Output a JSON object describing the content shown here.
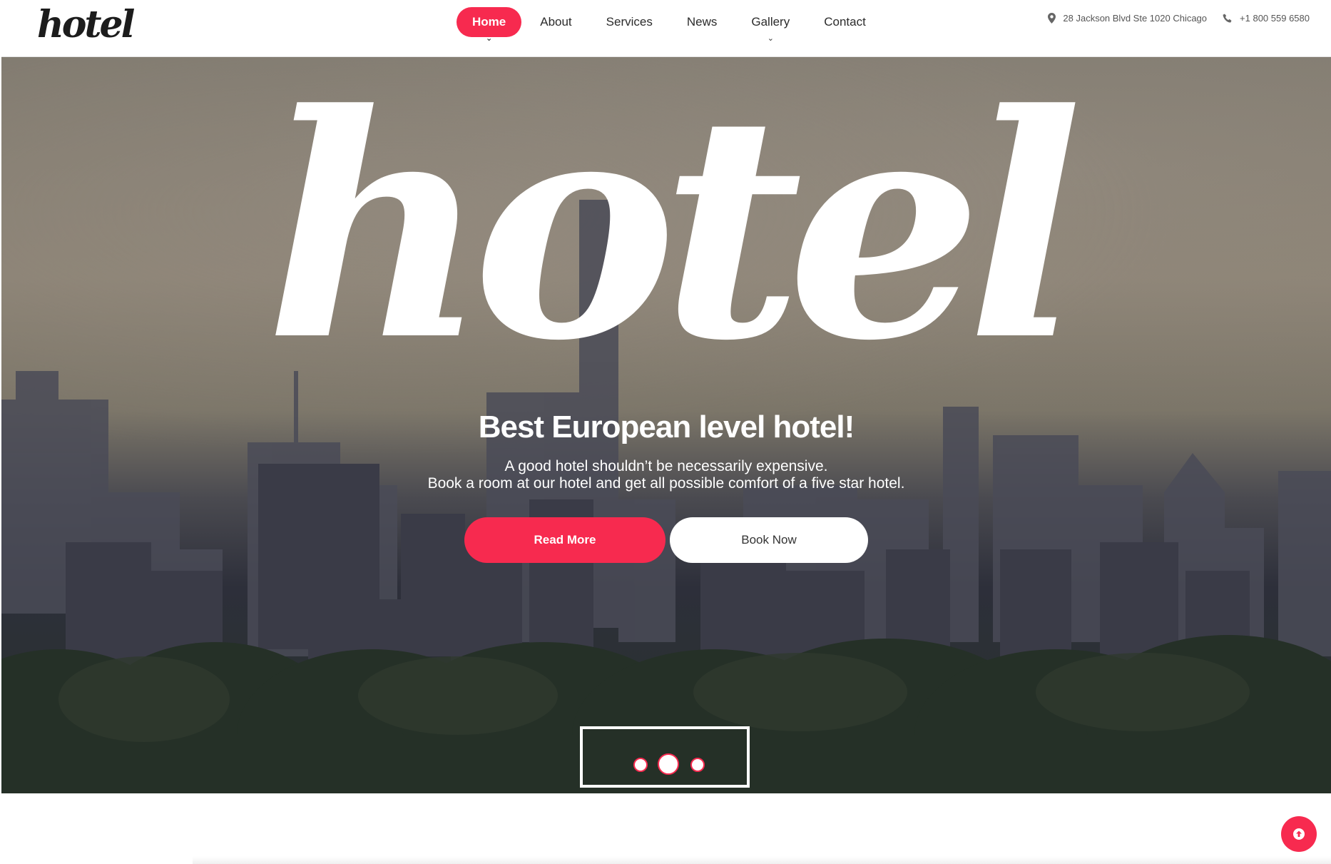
{
  "header": {
    "logo": "hotel",
    "nav": [
      {
        "label": "Home",
        "active": true,
        "has_dropdown": true
      },
      {
        "label": "About",
        "active": false,
        "has_dropdown": false
      },
      {
        "label": "Services",
        "active": false,
        "has_dropdown": false
      },
      {
        "label": "News",
        "active": false,
        "has_dropdown": false
      },
      {
        "label": "Gallery",
        "active": false,
        "has_dropdown": true
      },
      {
        "label": "Contact",
        "active": false,
        "has_dropdown": false
      }
    ],
    "address": "28 Jackson Blvd Ste 1020 Chicago",
    "phone": "+1 800 559 6580",
    "address_icon": "map-pin-icon",
    "phone_icon": "phone-icon"
  },
  "hero": {
    "script_text": "hotel",
    "title": "Best European level hotel!",
    "subtitle_line1": "A good hotel shouldn’t be necessarily expensive.",
    "subtitle_line2": "Book a room at our hotel and get all possible comfort of a five star hotel.",
    "read_more": "Read More",
    "book_now": "Book Now",
    "slides_total": 3,
    "active_slide": 2
  },
  "colors": {
    "accent": "#f72a4f",
    "white": "#ffffff"
  },
  "scroll_top_icon": "arrow-up-circle-icon"
}
